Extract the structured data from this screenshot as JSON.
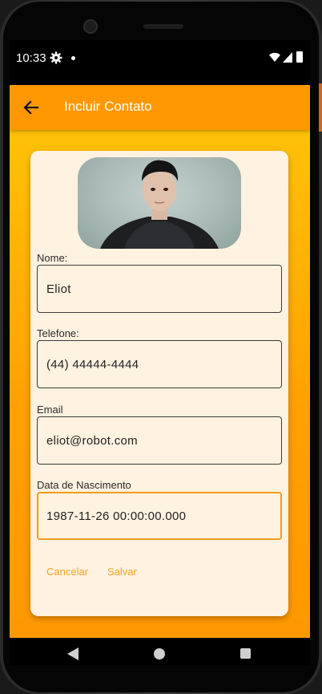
{
  "status_bar": {
    "time": "10:33",
    "icons": [
      "gear-icon",
      "notification-dot-icon",
      "wifi-icon",
      "cellular-icon",
      "battery-icon"
    ]
  },
  "app_bar": {
    "back_icon": "arrow-left-icon",
    "title": "Incluir Contato",
    "color": "#ff9800"
  },
  "contact_photo": {
    "icon": "contact-photo"
  },
  "form": {
    "name_label": "Nome:",
    "name_value": "Eliot",
    "phone_label": "Telefone:",
    "phone_value": "(44) 44444-4444",
    "email_label": "Email",
    "email_value": "eliot@robot.com",
    "birth_label": "Data de Nascimento",
    "birth_value": "1987-11-26 00:00:00.000"
  },
  "actions": {
    "cancel_label": "Cancelar",
    "save_label": "Salvar",
    "accent_color": "#f7a421"
  },
  "nav_bar": {
    "icons": [
      "nav-back-icon",
      "nav-home-icon",
      "nav-recent-icon"
    ]
  }
}
